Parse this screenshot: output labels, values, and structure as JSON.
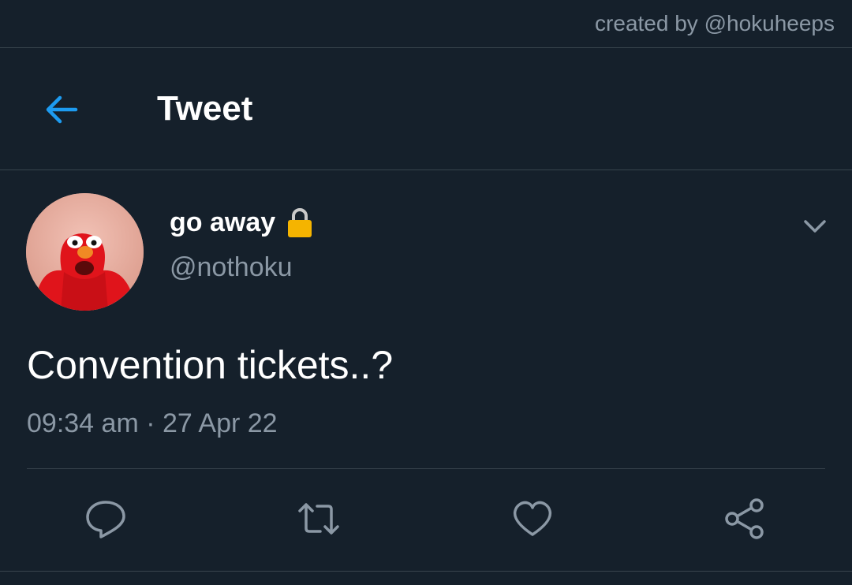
{
  "watermark": "created by @hokuheeps",
  "header": {
    "title": "Tweet",
    "back_icon": "arrow-left-icon"
  },
  "tweet": {
    "display_name": "go away",
    "protected_icon": "lock-icon",
    "handle": "@nothoku",
    "text": "Convention tickets..?",
    "time": "09:34 am",
    "separator": "·",
    "date": "27 Apr 22",
    "menu_icon": "chevron-down-icon"
  },
  "actions": {
    "reply_icon": "reply-icon",
    "retweet_icon": "retweet-icon",
    "like_icon": "heart-icon",
    "share_icon": "share-icon"
  },
  "colors": {
    "background": "#15202b",
    "accent": "#1d9bf0",
    "secondary_text": "#8b98a5",
    "divider": "#38444d",
    "lock": "#f5b400"
  }
}
